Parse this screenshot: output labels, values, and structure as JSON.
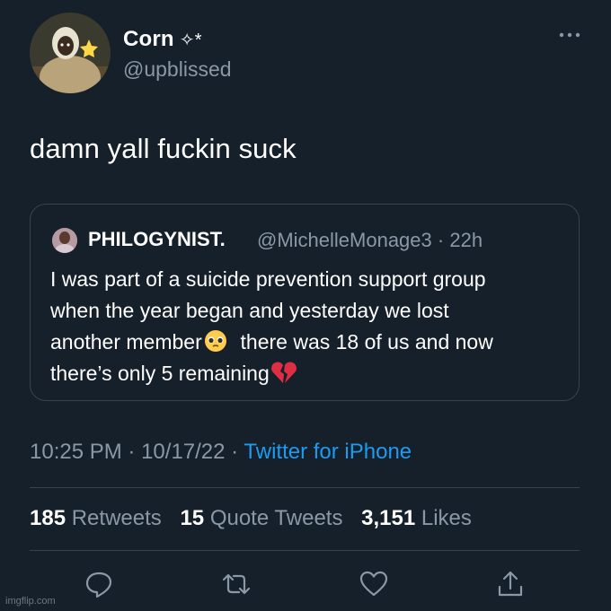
{
  "tweet": {
    "author": {
      "name": "Corn",
      "name_decoration": "✧*",
      "handle": "@upblissed",
      "avatar_icon": "profile-photo"
    },
    "text": "damn yall fuckin suck",
    "more_icon": "more-options-icon",
    "quoted": {
      "name": "PHILOGYNIST.",
      "handle": "@MichelleMonage3",
      "time": "22h",
      "separator": "·",
      "text_lines": [
        "I was part of a suicide prevention support group",
        "when the year began and yesterday we lost",
        "another member",
        "there was 18 of us and now",
        "there’s only 5 remaining"
      ],
      "emojis": [
        "pleading-face-emoji",
        "broken-heart-emoji"
      ]
    },
    "meta": {
      "time": "10:25 PM",
      "date": "10/17/22",
      "source": "Twitter for iPhone",
      "separator": "·"
    },
    "stats": {
      "retweets_count": "185",
      "retweets_label": "Retweets",
      "quote_count": "15",
      "quote_label": "Quote Tweets",
      "likes_count": "3,151",
      "likes_label": "Likes"
    },
    "actions": [
      "reply-icon",
      "retweet-icon",
      "like-icon",
      "share-icon"
    ]
  },
  "watermark": "imgflip.com",
  "colors": {
    "background": "#15202b",
    "secondary_text": "#8b98a5",
    "link": "#1d9bf0",
    "border": "#38444d"
  }
}
